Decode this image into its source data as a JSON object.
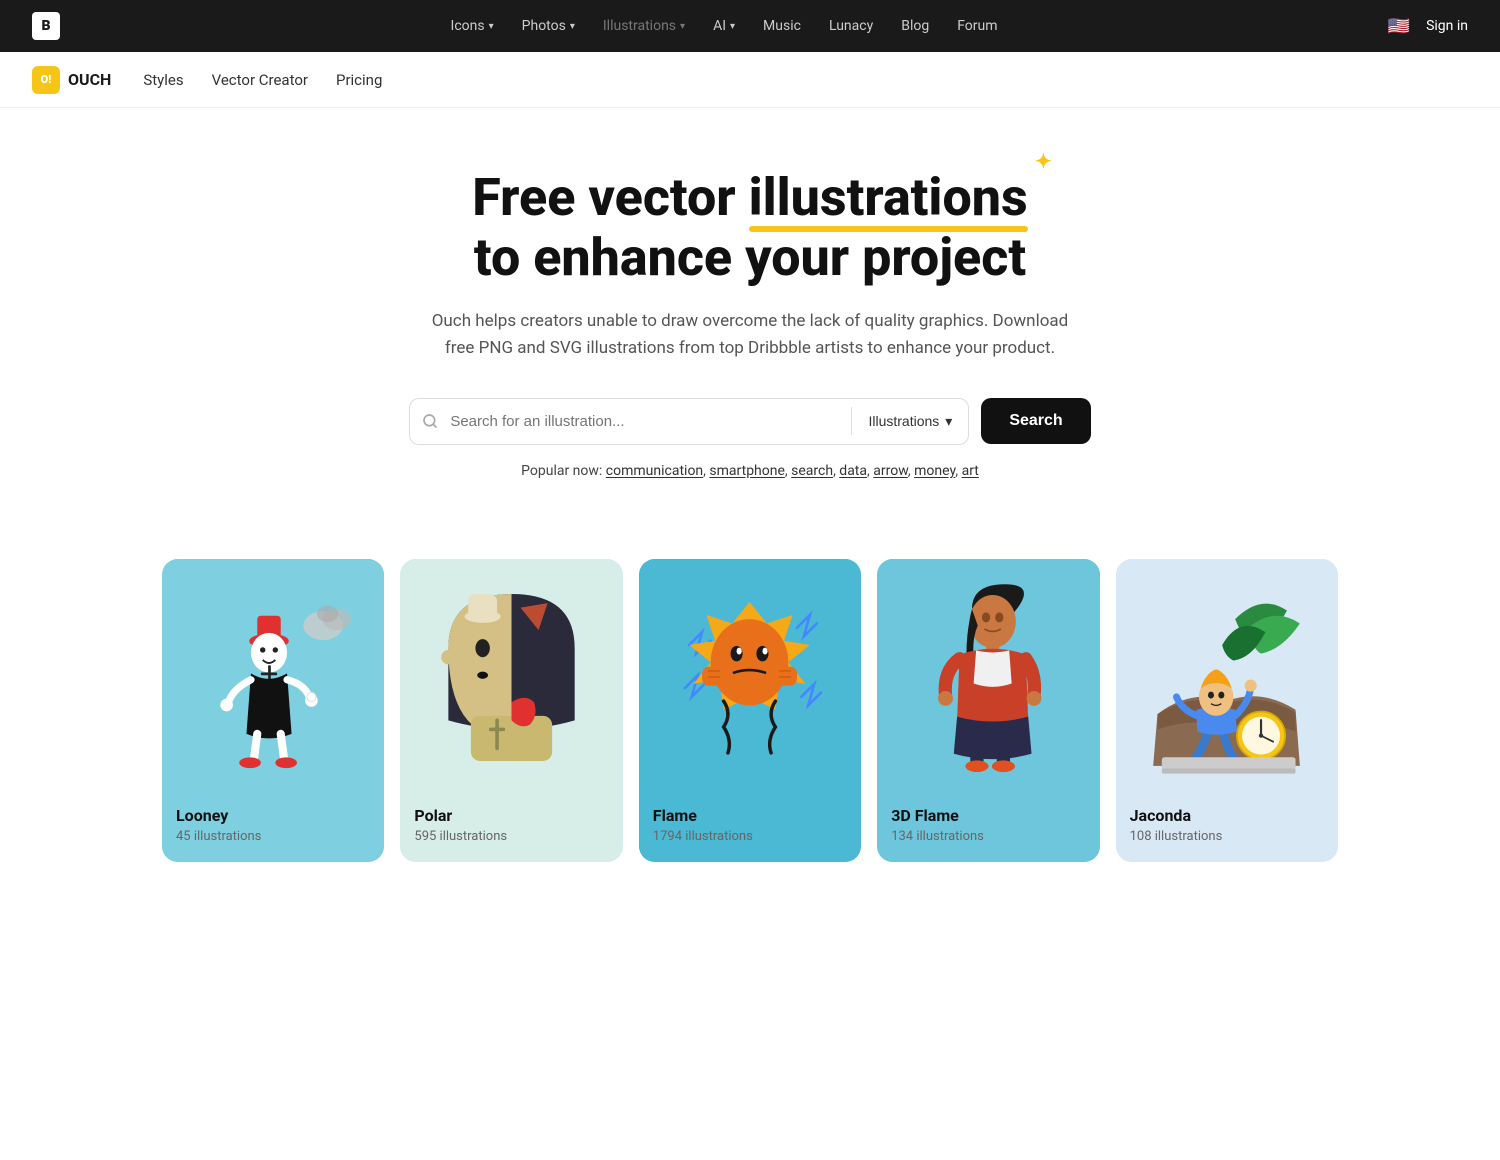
{
  "topNav": {
    "logo": "B",
    "links": [
      {
        "label": "Icons",
        "hasDropdown": true,
        "active": false
      },
      {
        "label": "Photos",
        "hasDropdown": true,
        "active": false
      },
      {
        "label": "Illustrations",
        "hasDropdown": true,
        "active": true
      },
      {
        "label": "AI",
        "hasDropdown": true,
        "active": false
      },
      {
        "label": "Music",
        "hasDropdown": false,
        "active": false
      },
      {
        "label": "Lunacy",
        "hasDropdown": false,
        "active": false
      },
      {
        "label": "Blog",
        "hasDropdown": false,
        "active": false
      },
      {
        "label": "Forum",
        "hasDropdown": false,
        "active": false
      }
    ],
    "flag": "🇺🇸",
    "signin": "Sign in"
  },
  "subNav": {
    "brand": "OUCH",
    "badgeText": "O!",
    "links": [
      "Styles",
      "Vector Creator",
      "Pricing"
    ]
  },
  "hero": {
    "titleLine1": "Free vector ",
    "titleHighlight": "illustrations",
    "titleLine2": "to enhance your project",
    "subtitle": "Ouch helps creators unable to draw overcome the lack of quality graphics. Download free PNG and SVG illustrations from top Dribbble artists to enhance your product.",
    "searchPlaceholder": "Search for an illustration...",
    "searchDropdown": "Illustrations",
    "searchButton": "Search",
    "popularLabel": "Popular now:",
    "popularLinks": [
      "communication",
      "smartphone",
      "search",
      "data",
      "arrow",
      "money",
      "art"
    ]
  },
  "cards": [
    {
      "id": "looney",
      "title": "Looney",
      "count": "45 illustrations",
      "bgClass": "card-looney"
    },
    {
      "id": "polar",
      "title": "Polar",
      "count": "595 illustrations",
      "bgClass": "card-polar"
    },
    {
      "id": "flame",
      "title": "Flame",
      "count": "1794 illustrations",
      "bgClass": "card-flame"
    },
    {
      "id": "3dflame",
      "title": "3D Flame",
      "count": "134 illustrations",
      "bgClass": "card-3dflame"
    },
    {
      "id": "jaconda",
      "title": "Jaconda",
      "count": "108 illustrations",
      "bgClass": "card-jaconda"
    }
  ]
}
